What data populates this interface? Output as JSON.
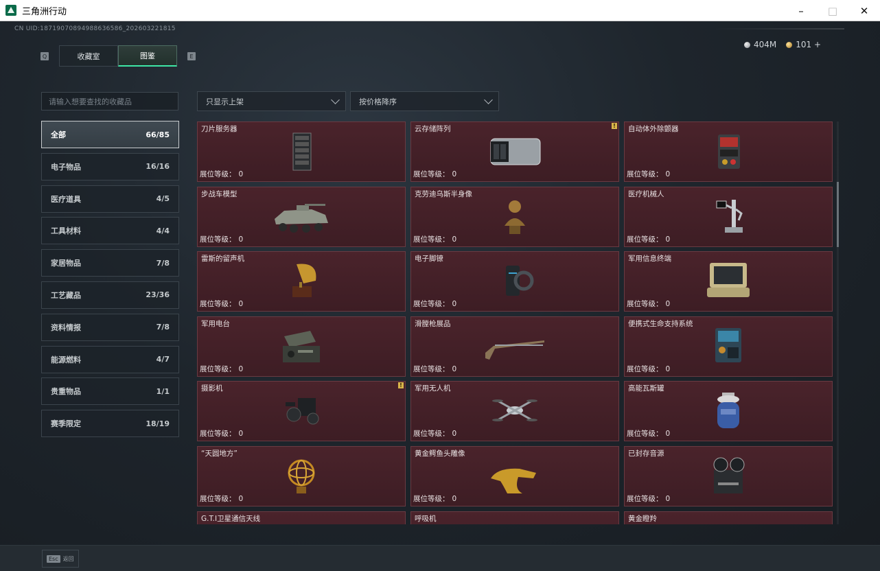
{
  "window": {
    "title": "三角洲行动",
    "controls": {
      "minimize": "–",
      "maximize": "□",
      "close": "✕"
    }
  },
  "header": {
    "uid": "CN UID:18719070894988636586_202603221815",
    "currency": [
      {
        "icon": "silver-coin-icon",
        "value": "404M"
      },
      {
        "icon": "gold-coin-icon",
        "value": "101 +"
      }
    ]
  },
  "tabs": {
    "left_key": "Q",
    "right_key": "E",
    "items": [
      {
        "label": "收藏室",
        "active": false
      },
      {
        "label": "图鉴",
        "active": true
      }
    ]
  },
  "search": {
    "placeholder": "请输入想要查找的收藏品"
  },
  "categories": [
    {
      "label": "全部",
      "count": "66/85",
      "active": true
    },
    {
      "label": "电子物品",
      "count": "16/16"
    },
    {
      "label": "医疗道具",
      "count": "4/5"
    },
    {
      "label": "工具材料",
      "count": "4/4"
    },
    {
      "label": "家居物品",
      "count": "7/8"
    },
    {
      "label": "工艺藏品",
      "count": "23/36"
    },
    {
      "label": "资料情报",
      "count": "7/8"
    },
    {
      "label": "能源燃料",
      "count": "4/7"
    },
    {
      "label": "贵重物品",
      "count": "1/1"
    },
    {
      "label": "赛季限定",
      "count": "18/19"
    }
  ],
  "filters": {
    "shelf": "只显示上架",
    "sort": "按价格降序"
  },
  "grid": {
    "level_label": "展位等级：",
    "items": [
      {
        "name": "刀片服务器",
        "level": "0",
        "art": "server-icon"
      },
      {
        "name": "云存储阵列",
        "level": "0",
        "art": "storage-array-icon",
        "badge": "!"
      },
      {
        "name": "自动体外除颤器",
        "level": "0",
        "art": "defibrillator-icon"
      },
      {
        "name": "步战车模型",
        "level": "0",
        "art": "ifv-model-icon"
      },
      {
        "name": "克劳迪乌斯半身像",
        "level": "0",
        "art": "bust-icon"
      },
      {
        "name": "医疗机械人",
        "level": "0",
        "art": "medical-robot-icon"
      },
      {
        "name": "雷斯的留声机",
        "level": "0",
        "art": "gramophone-icon"
      },
      {
        "name": "电子脚镣",
        "level": "0",
        "art": "ankle-monitor-icon"
      },
      {
        "name": "军用信息终端",
        "level": "0",
        "art": "terminal-icon"
      },
      {
        "name": "军用电台",
        "level": "0",
        "art": "radio-icon"
      },
      {
        "name": "滑膛枪展品",
        "level": "0",
        "art": "musket-icon"
      },
      {
        "name": "便携式生命支持系统",
        "level": "0",
        "art": "life-support-icon"
      },
      {
        "name": "摄影机",
        "level": "0",
        "art": "camera-icon",
        "badge": "!"
      },
      {
        "name": "军用无人机",
        "level": "0",
        "art": "drone-icon"
      },
      {
        "name": "高能瓦斯罐",
        "level": "0",
        "art": "gas-tank-icon"
      },
      {
        "name": "“天圆地方”",
        "level": "0",
        "art": "armillary-icon"
      },
      {
        "name": "黄金鳄鱼头雕像",
        "level": "0",
        "art": "croc-statue-icon"
      },
      {
        "name": "已封存音源",
        "level": "0",
        "art": "reel-recorder-icon"
      },
      {
        "name": "G.T.I卫星通信天线",
        "level": "",
        "art": "satellite-icon"
      },
      {
        "name": "呼吸机",
        "level": "",
        "art": "ventilator-icon"
      },
      {
        "name": "黄金瞪羚",
        "level": "",
        "art": "gazelle-icon"
      }
    ]
  },
  "footer": {
    "esc_key": "Esc",
    "esc_label": "返回"
  }
}
